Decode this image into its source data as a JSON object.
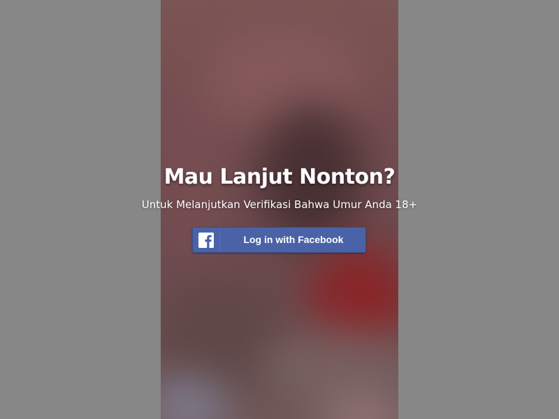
{
  "overlay": {
    "title": "Mau Lanjut Nonton?",
    "subtitle": "Untuk Melanjutkan Verifikasi Bahwa Umur Anda 18+"
  },
  "login": {
    "button_label": "Log in with Facebook",
    "icon": "facebook-logo-icon"
  },
  "colors": {
    "backdrop": "#878787",
    "facebook_blue": "#4a62a8",
    "text": "#ffffff"
  }
}
